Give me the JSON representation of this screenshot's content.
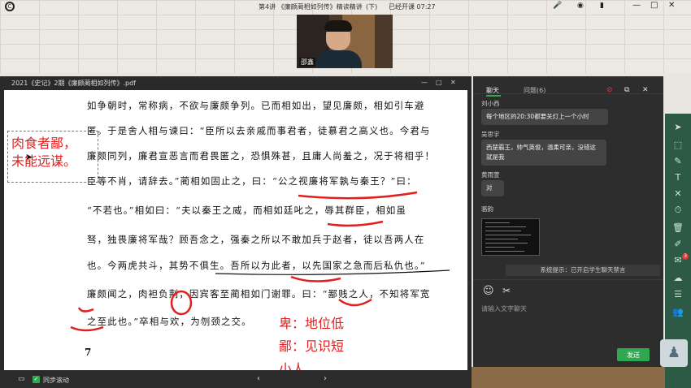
{
  "top_bar": {
    "lesson_title": "第4讲 《廉颇蔺相如列传》精读精讲",
    "mode_badge": "(下)",
    "class_time": "已经开课 07:27"
  },
  "webcam": {
    "label": "邵鑫"
  },
  "pdf": {
    "title": "2021《史记》2期《廉颇蔺相如列传》.pdf",
    "lines": [
      "如争朝时，常称病，不欲与廉颇争列。已而相如出，望见廉颇，相如引车避",
      "匿。于是舍人相与谏曰：“臣所以去亲戚而事君者，徒慕君之高义也。今君与",
      "廉颇同列，廉君宣恶言而君畏匿之，恐惧殊甚，且庸人尚羞之，况于将相乎！",
      "臣等不肖，请辞去。”蔺相如固止之，曰：“公之视廉将军孰与秦王？”曰：",
      "“不若也。”相如曰：“夫以秦王之威，而相如廷叱之，辱其群臣，相如虽",
      "驽，独畏廉将军哉？顾吾念之，强秦之所以不敢加兵于赵者，徒以吾两人在",
      "也。今两虎共斗，其势不俱生。吾所以为此者，以先国家之急而后私仇也。”",
      "廉颇闻之，肉袒负荆，因宾客至蔺相如门谢罪。曰：“鄙贱之人，不知将军宽",
      "之至此也。”卒相与欢，为刎颈之交。"
    ],
    "page_number": "7",
    "annotation_box": "肉食者鄙，\n未能远谋。",
    "annotation_note_1": "卑：地位低",
    "annotation_note_2": "鄙：见识短",
    "annotation_note_3": "小人",
    "sync_label": "同步滚动",
    "current_page": "4",
    "total_pages": "/ 6"
  },
  "chat": {
    "tab_chat": "聊天",
    "tab_questions": "问题(6)",
    "messages": [
      {
        "sender": "刘小西",
        "text": "每个地区的20:30都要关灯上一个小时"
      },
      {
        "sender": "吴思宇",
        "text": "西楚霸王，帅气英俊，温柔可亲，没错这就是我"
      },
      {
        "sender": "黄雨萱",
        "text": "对"
      },
      {
        "sender": "骆韵",
        "text": ""
      }
    ],
    "system_tip": "系统提示：已开启学生聊天禁言",
    "input_placeholder": "请输入文字聊天",
    "send_label": "发送"
  },
  "toolbar": {
    "badge_count": "3"
  },
  "colors": {
    "accent_green": "#2fa84f",
    "annotation_red": "#e02020"
  }
}
